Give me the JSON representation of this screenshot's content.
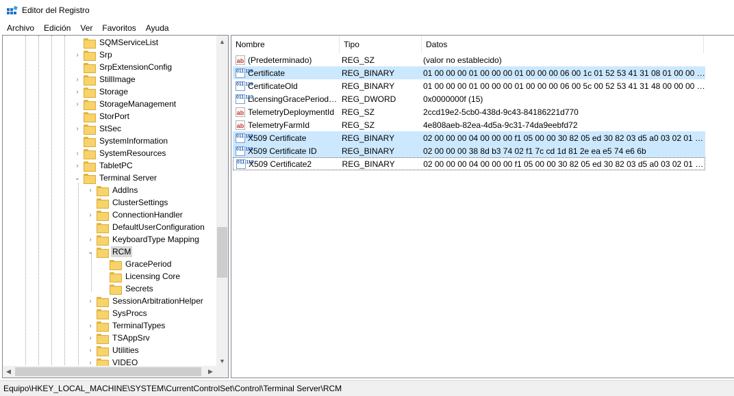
{
  "window": {
    "title": "Editor del Registro"
  },
  "menu": [
    "Archivo",
    "Edición",
    "Ver",
    "Favoritos",
    "Ayuda"
  ],
  "tree": [
    {
      "label": "SQMServiceList",
      "depth": 0,
      "toggle": ""
    },
    {
      "label": "Srp",
      "depth": 0,
      "toggle": "collapsed"
    },
    {
      "label": "SrpExtensionConfig",
      "depth": 0,
      "toggle": ""
    },
    {
      "label": "StillImage",
      "depth": 0,
      "toggle": "collapsed"
    },
    {
      "label": "Storage",
      "depth": 0,
      "toggle": "collapsed"
    },
    {
      "label": "StorageManagement",
      "depth": 0,
      "toggle": "collapsed"
    },
    {
      "label": "StorPort",
      "depth": 0,
      "toggle": ""
    },
    {
      "label": "StSec",
      "depth": 0,
      "toggle": "collapsed"
    },
    {
      "label": "SystemInformation",
      "depth": 0,
      "toggle": ""
    },
    {
      "label": "SystemResources",
      "depth": 0,
      "toggle": "collapsed"
    },
    {
      "label": "TabletPC",
      "depth": 0,
      "toggle": "collapsed"
    },
    {
      "label": "Terminal Server",
      "depth": 0,
      "toggle": "expanded"
    },
    {
      "label": "AddIns",
      "depth": 1,
      "toggle": "collapsed"
    },
    {
      "label": "ClusterSettings",
      "depth": 1,
      "toggle": ""
    },
    {
      "label": "ConnectionHandler",
      "depth": 1,
      "toggle": "collapsed"
    },
    {
      "label": "DefaultUserConfiguration",
      "depth": 1,
      "toggle": ""
    },
    {
      "label": "KeyboardType Mapping",
      "depth": 1,
      "toggle": "collapsed"
    },
    {
      "label": "RCM",
      "depth": 1,
      "toggle": "expanded",
      "selected": true
    },
    {
      "label": "GracePeriod",
      "depth": 2,
      "toggle": ""
    },
    {
      "label": "Licensing Core",
      "depth": 2,
      "toggle": ""
    },
    {
      "label": "Secrets",
      "depth": 2,
      "toggle": ""
    },
    {
      "label": "SessionArbitrationHelper",
      "depth": 1,
      "toggle": "collapsed"
    },
    {
      "label": "SysProcs",
      "depth": 1,
      "toggle": ""
    },
    {
      "label": "TerminalTypes",
      "depth": 1,
      "toggle": "collapsed"
    },
    {
      "label": "TSAppSrv",
      "depth": 1,
      "toggle": "collapsed"
    },
    {
      "label": "Utilities",
      "depth": 1,
      "toggle": "collapsed"
    },
    {
      "label": "VIDEO",
      "depth": 1,
      "toggle": "collapsed"
    }
  ],
  "list": {
    "columns": [
      "Nombre",
      "Tipo",
      "Datos"
    ],
    "rows": [
      {
        "name": "(Predeterminado)",
        "type": "REG_SZ",
        "data": "(valor no establecido)",
        "icon": "string",
        "state": ""
      },
      {
        "name": "Certificate",
        "type": "REG_BINARY",
        "data": "01 00 00 00 01 00 00 00 01 00 00 00 06 00 1c 01 52 53 41 31 08 01 00 00 00 08 ...",
        "icon": "binary",
        "state": "selected"
      },
      {
        "name": "CertificateOld",
        "type": "REG_BINARY",
        "data": "01 00 00 00 01 00 00 00 01 00 00 00 06 00 5c 00 52 53 41 31 48 00 00 00 00 02 ...",
        "icon": "binary",
        "state": ""
      },
      {
        "name": "LicensingGracePeriodE...",
        "type": "REG_DWORD",
        "data": "0x0000000f (15)",
        "icon": "binary",
        "state": ""
      },
      {
        "name": "TelemetryDeploymentId",
        "type": "REG_SZ",
        "data": "2ccd19e2-5cb0-438d-9c43-84186221d770",
        "icon": "string",
        "state": ""
      },
      {
        "name": "TelemetryFarmId",
        "type": "REG_SZ",
        "data": "4e808aeb-82ea-4d5a-9c31-74da9eebfd72",
        "icon": "string",
        "state": ""
      },
      {
        "name": "X509 Certificate",
        "type": "REG_BINARY",
        "data": "02 00 00 00 04 00 00 00 f1 05 00 00 30 82 05 ed 30 82 03 d5 a0 03 02 01 02 02 ...",
        "icon": "binary",
        "state": "selected"
      },
      {
        "name": "X509 Certificate ID",
        "type": "REG_BINARY",
        "data": "02 00 00 00 38 8d b3 74 02 f1 7c cd 1d 81 2e ea e5 74 e6 6b",
        "icon": "binary",
        "state": "selected"
      },
      {
        "name": "X509 Certificate2",
        "type": "REG_BINARY",
        "data": "02 00 00 00 04 00 00 00 f1 05 00 00 30 82 05 ed 30 82 03 d5 a0 03 02 01 02 02 ...",
        "icon": "binary",
        "state": "focused"
      }
    ]
  },
  "status": {
    "path": "Equipo\\HKEY_LOCAL_MACHINE\\SYSTEM\\CurrentControlSet\\Control\\Terminal Server\\RCM"
  },
  "icons": {
    "string": "ab",
    "binary": "011 110",
    "up": "▲",
    "down": "▼",
    "left": "◀",
    "right": "▶",
    "collapsed": "›",
    "expanded": "⌄"
  }
}
